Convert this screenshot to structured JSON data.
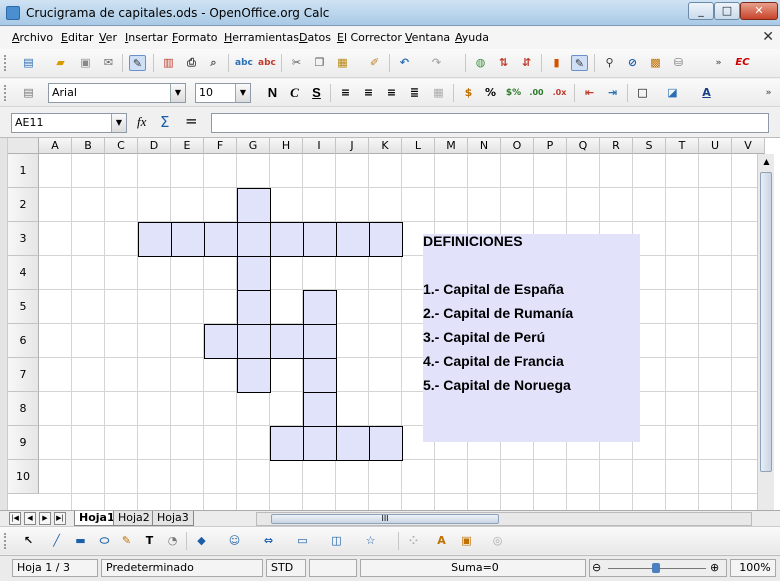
{
  "window": {
    "title": "Crucigrama de capitales.ods - OpenOffice.org Calc",
    "minimize": "_",
    "maximize": "□",
    "close": "✕"
  },
  "menu": [
    "Archivo",
    "Editar",
    "Ver",
    "Insertar",
    "Formato",
    "Herramientas",
    "Datos",
    "El Corrector",
    "Ventana",
    "Ayuda"
  ],
  "formatting": {
    "font_name": "Arial",
    "font_size": "10",
    "bold": "N",
    "italic": "C",
    "underline": "S"
  },
  "formula_bar": {
    "name_box": "AE11",
    "function_wizard": "fx",
    "sum_symbol": "Σ",
    "equals_symbol": "=",
    "value": ""
  },
  "columns": [
    "A",
    "B",
    "C",
    "D",
    "E",
    "F",
    "G",
    "H",
    "I",
    "J",
    "K",
    "L",
    "M",
    "N",
    "O",
    "P",
    "Q",
    "R",
    "S",
    "T",
    "U",
    "V"
  ],
  "rows": [
    "1",
    "2",
    "3",
    "4",
    "5",
    "6",
    "7",
    "8",
    "9",
    "10"
  ],
  "crossword_cells": [
    [
      "G",
      2
    ],
    [
      "D",
      3
    ],
    [
      "E",
      3
    ],
    [
      "F",
      3
    ],
    [
      "G",
      3
    ],
    [
      "H",
      3
    ],
    [
      "I",
      3
    ],
    [
      "J",
      3
    ],
    [
      "K",
      3
    ],
    [
      "G",
      4
    ],
    [
      "G",
      5
    ],
    [
      "I",
      5
    ],
    [
      "F",
      6
    ],
    [
      "G",
      6
    ],
    [
      "H",
      6
    ],
    [
      "I",
      6
    ],
    [
      "G",
      7
    ],
    [
      "I",
      7
    ],
    [
      "I",
      8
    ],
    [
      "H",
      9
    ],
    [
      "I",
      9
    ],
    [
      "J",
      9
    ],
    [
      "K",
      9
    ]
  ],
  "definitions": {
    "heading": "DEFINICIONES",
    "items": [
      "1.- Capital de España",
      "2.- Capital de Rumanía",
      "3.- Capital de Perú",
      "4.- Capital de Francia",
      "5.- Capital de Noruega"
    ]
  },
  "sheet_tabs": [
    "Hoja1",
    "Hoja2",
    "Hoja3"
  ],
  "active_sheet": "Hoja1",
  "hscroll_thumb_label": "III",
  "status": {
    "sheet": "Hoja 1 / 3",
    "style": "Predeterminado",
    "mode": "STD",
    "sum": "Suma=0",
    "zoom": "100%",
    "zoom_minus": "⊖",
    "zoom_plus": "⊕"
  },
  "colors": {
    "crossword_fill": "#e0e3fa",
    "definitions_fill": "#e2e3fb"
  }
}
